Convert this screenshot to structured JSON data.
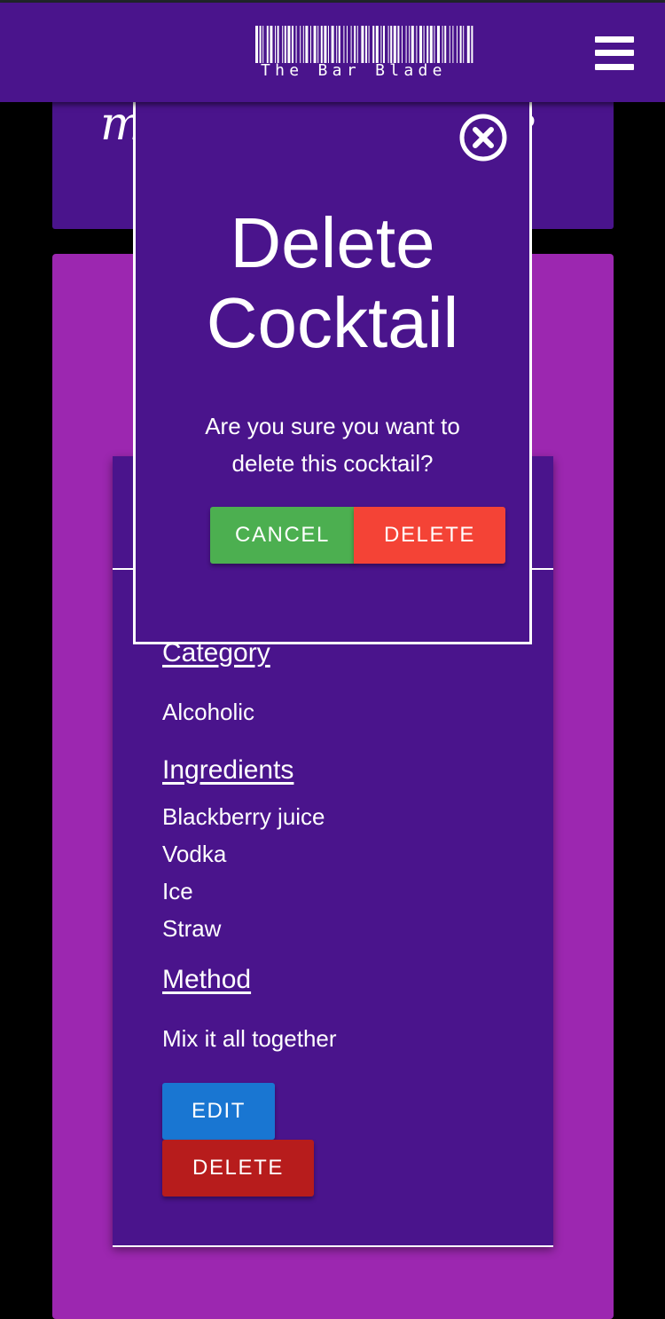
{
  "navbar": {
    "brand_text": "The Bar Blade",
    "menu_icon": "hamburger-menu-icon",
    "color": "#4a148c"
  },
  "header_card": {
    "title_fragment_left": "m",
    "title_fragment_right": "le"
  },
  "cocktail": {
    "category_heading": "Category",
    "category": "Alcoholic",
    "ingredients_heading": "Ingredients",
    "ingredients": [
      "Blackberry juice",
      "Vodka",
      "Ice",
      "Straw"
    ],
    "method_heading": "Method",
    "method": "Mix it all together",
    "edit_label": "EDIT",
    "delete_label": "DELETE"
  },
  "modal": {
    "title_line1": "Delete",
    "title_line2": "Cocktail",
    "message_line1": "Are you sure you want to",
    "message_line2": "delete this cocktail?",
    "cancel_label": "CANCEL",
    "confirm_label": "DELETE",
    "close_icon": "close-circle-icon"
  },
  "colors": {
    "primary": "#4a148c",
    "accent": "#9c27b0",
    "cancel": "#4caf50",
    "confirm_delete": "#f44336",
    "edit": "#1976d2",
    "delete": "#b71c1c"
  }
}
